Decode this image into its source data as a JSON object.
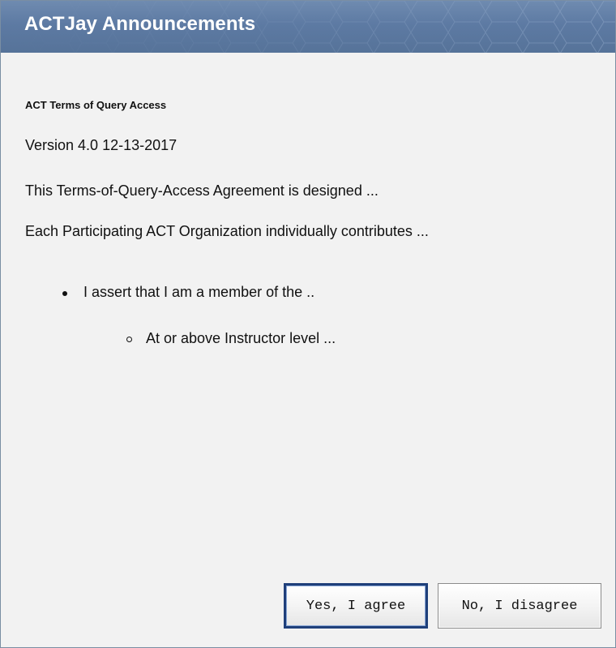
{
  "dialog": {
    "title": "ACTJay Announcements"
  },
  "content": {
    "heading": "ACT Terms of Query Access",
    "version": "Version 4.0 12-13-2017",
    "paragraph1": "This Terms-of-Query-Access Agreement is designed ...",
    "paragraph2": "Each Participating ACT Organization individually contributes ...",
    "bullet1": "I assert that I am a member of the ..",
    "bullet2": "At or above Instructor level ..."
  },
  "buttons": {
    "agree_label": "Yes, I agree",
    "disagree_label": "No, I disagree"
  },
  "colors": {
    "titlebar": "#5d7aa3",
    "background": "#f2f2f2",
    "focus_border": "#1f3f7a"
  }
}
